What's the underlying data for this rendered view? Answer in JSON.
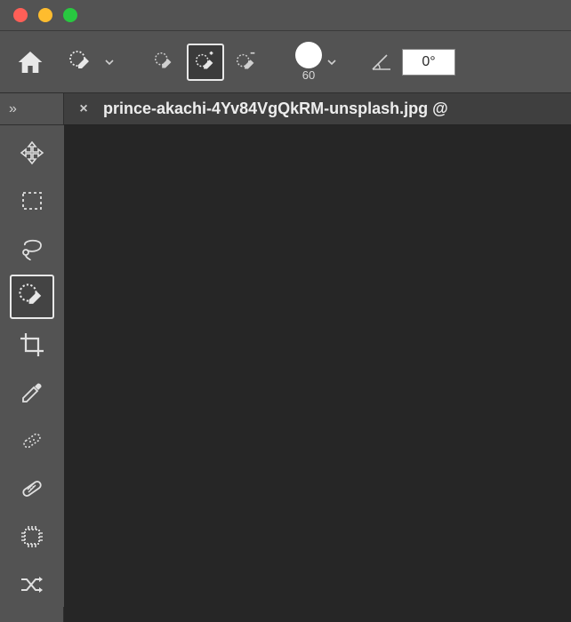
{
  "titlebar": {
    "close_color": "#ff5f57",
    "min_color": "#febc2e",
    "max_color": "#28c840"
  },
  "optbar": {
    "home_icon": "home-icon",
    "selection_brush_icon": "selection-brush-icon",
    "mode_new_icon": "new-selection-icon",
    "mode_add_icon": "add-to-selection-icon",
    "mode_subtract_icon": "subtract-from-selection-icon",
    "brush_size": "60",
    "angle_value": "0°"
  },
  "tools": [
    {
      "name": "move-tool"
    },
    {
      "name": "marquee-tool"
    },
    {
      "name": "lasso-tool"
    },
    {
      "name": "selection-brush-tool",
      "selected": true
    },
    {
      "name": "crop-tool"
    },
    {
      "name": "eyedropper-tool"
    },
    {
      "name": "healing-brush-tool"
    },
    {
      "name": "brush-tool"
    },
    {
      "name": "cookie-cutter-tool"
    },
    {
      "name": "recompose-tool"
    }
  ],
  "panel_strip": {
    "expand_icon": "»"
  },
  "tab": {
    "close": "×",
    "label": "prince-akachi-4Yv84VgQkRM-unsplash.jpg @"
  }
}
